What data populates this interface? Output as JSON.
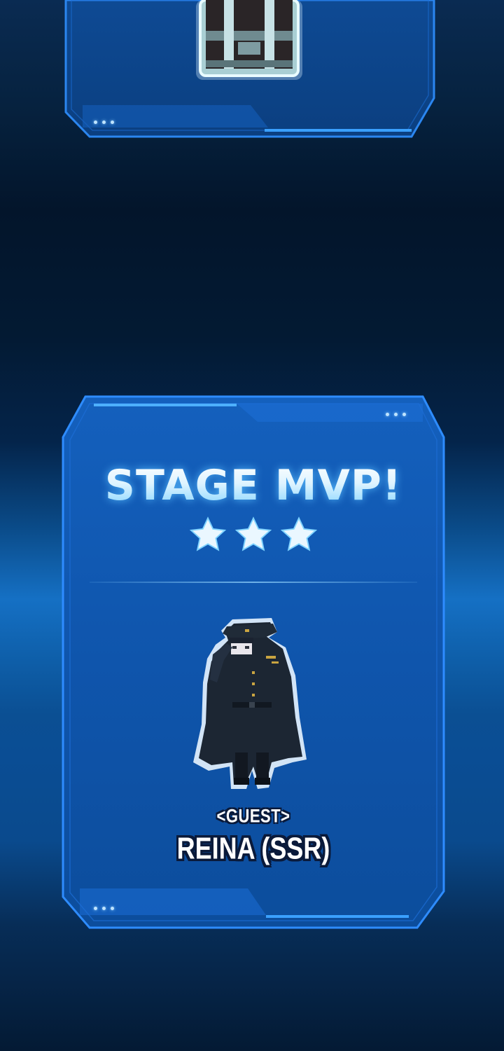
{
  "top_panel": {
    "reward_icon": "treasure-chest-icon"
  },
  "mvp_panel": {
    "title": "STAGE MVP!",
    "stars": 3,
    "star_icon": "star-icon",
    "character_icon": "character-sprite",
    "guest_label": "<GUEST>",
    "character_name": "REINA (SSR)"
  },
  "colors": {
    "panel_fill": "#0f57b0",
    "panel_border": "#2f8fff",
    "title_glow": "#7fd3ff",
    "star_fill": "#eaf7ff"
  }
}
